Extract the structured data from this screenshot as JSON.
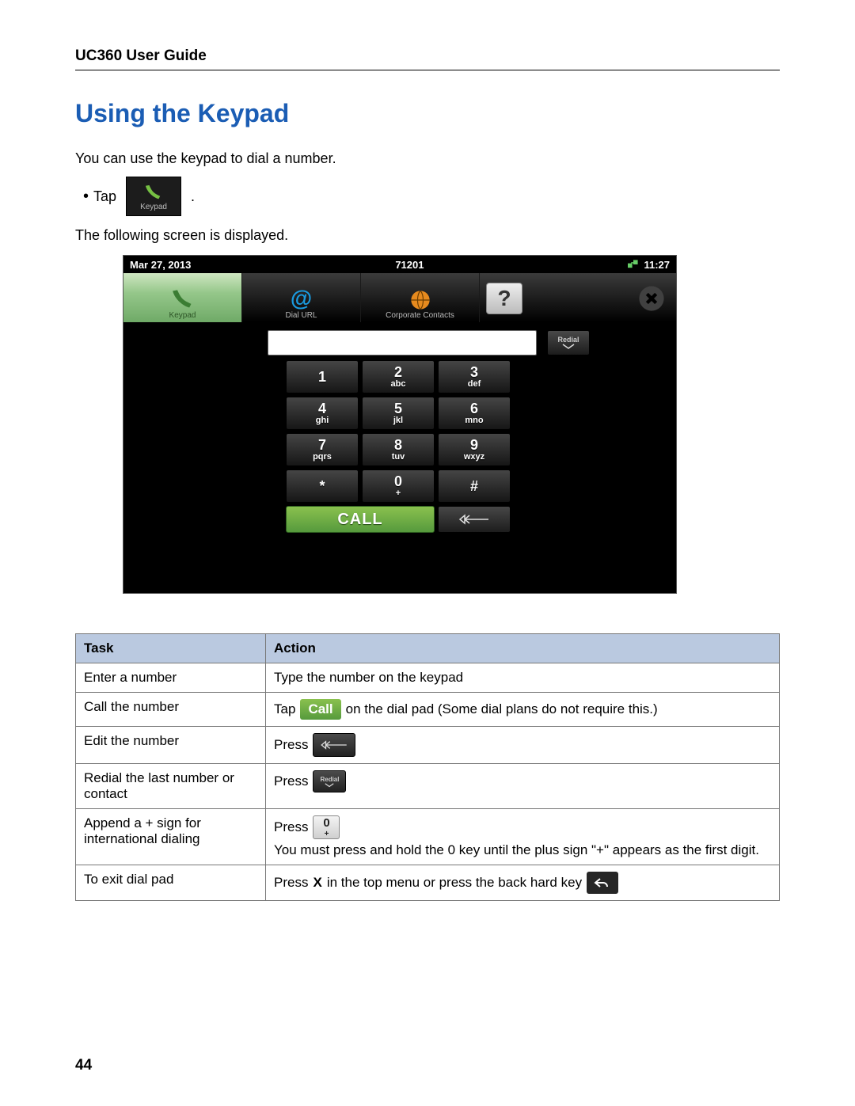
{
  "doc": {
    "header": "UC360 User Guide",
    "page_number": "44",
    "heading": "Using the Keypad",
    "intro": "You can use the keypad to dial a number.",
    "tap_label": "Tap",
    "tap_tile_label": "Keypad",
    "followup": "The following screen is displayed."
  },
  "screen": {
    "statusbar": {
      "date": "Mar 27, 2013",
      "ext": "71201",
      "time": "11:27"
    },
    "tabs": {
      "keypad": "Keypad",
      "dialurl": "Dial URL",
      "contacts": "Corporate Contacts"
    },
    "redial_label": "Redial",
    "call_label": "CALL",
    "keys": [
      {
        "d": "1",
        "s": ""
      },
      {
        "d": "2",
        "s": "abc"
      },
      {
        "d": "3",
        "s": "def"
      },
      {
        "d": "4",
        "s": "ghi"
      },
      {
        "d": "5",
        "s": "jkl"
      },
      {
        "d": "6",
        "s": "mno"
      },
      {
        "d": "7",
        "s": "pqrs"
      },
      {
        "d": "8",
        "s": "tuv"
      },
      {
        "d": "9",
        "s": "wxyz"
      },
      {
        "d": "*",
        "s": ""
      },
      {
        "d": "0",
        "s": "+"
      },
      {
        "d": "#",
        "s": ""
      }
    ]
  },
  "table": {
    "headers": {
      "task": "Task",
      "action": "Action"
    },
    "rows": {
      "r1": {
        "task": "Enter a number",
        "action": "Type the number on the keypad"
      },
      "r2": {
        "task": "Call the number",
        "pre": "Tap",
        "call": "Call",
        "post": "on the dial pad (Some dial plans do not require this.)"
      },
      "r3": {
        "task": "Edit the number",
        "pre": "Press"
      },
      "r4": {
        "task": "Redial the last number or contact",
        "pre": "Press",
        "redial": "Redial"
      },
      "r5": {
        "task": "Append a + sign for international dialing",
        "pre": "Press",
        "zero": "0",
        "plus": "+",
        "post": "You must press and hold the 0 key until the plus sign \"+\" appears as the first digit."
      },
      "r6": {
        "task": "To exit dial pad",
        "pre": "Press ",
        "x": "X",
        "post": " in the top menu or press the back hard key"
      }
    }
  }
}
